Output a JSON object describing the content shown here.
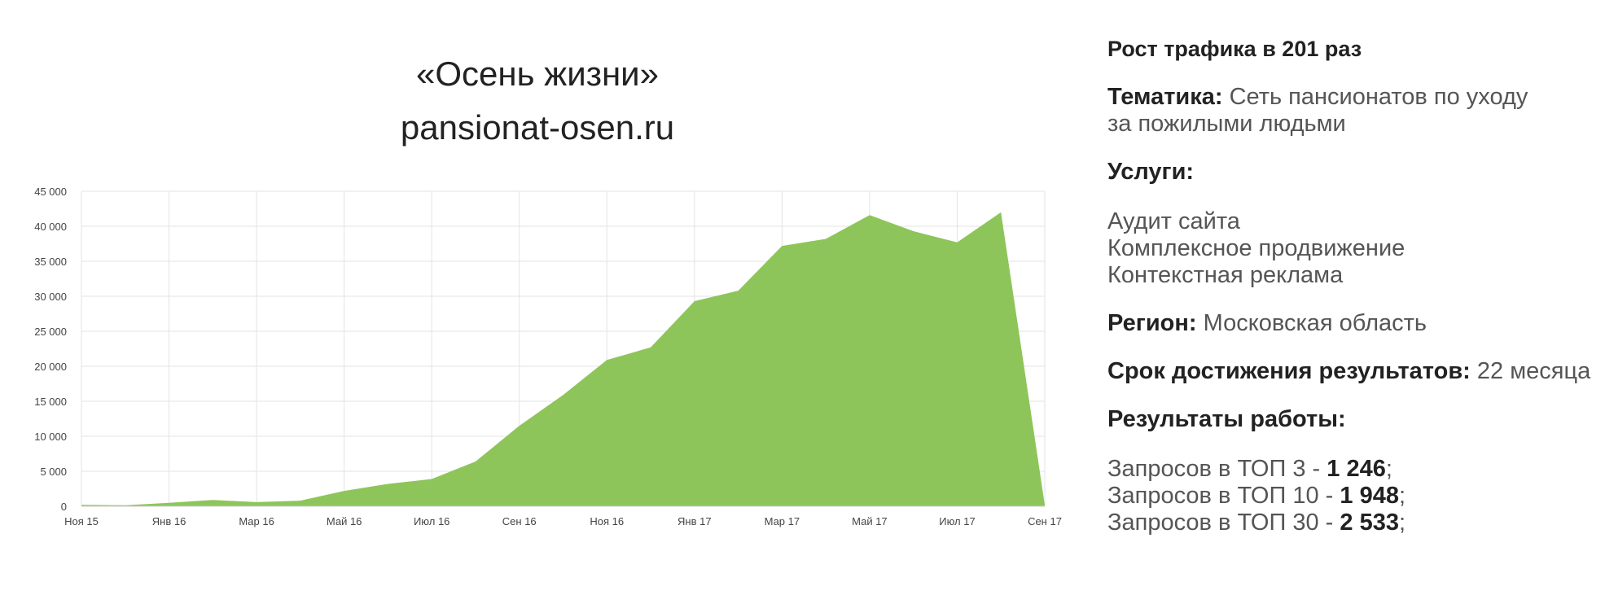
{
  "title": {
    "line1": "«Осень жизни»",
    "line2": "pansionat-osen.ru"
  },
  "info": {
    "headline": "Рост трафика в 201 раз",
    "theme_label": "Тематика:",
    "theme_value_line1": "Сеть пансионатов по уходу",
    "theme_value_line2": "за пожилыми людьми",
    "services_label": "Услуги:",
    "services": [
      "Аудит сайта",
      "Комплексное продвижение",
      "Контекстная реклама"
    ],
    "region_label": "Регион:",
    "region_value": "Московская область",
    "term_label": "Срок достижения результатов:",
    "term_value": "22 месяца",
    "results_label": "Результаты работы:",
    "results": [
      {
        "prefix": "Запросов в ТОП 3 - ",
        "value": "1 246",
        "suffix": ";"
      },
      {
        "prefix": "Запросов в ТОП 10 - ",
        "value": "1 948",
        "suffix": ";"
      },
      {
        "prefix": "Запросов в ТОП 30 - ",
        "value": "2 533",
        "suffix": ";"
      }
    ]
  },
  "chart_data": {
    "type": "area",
    "title": "",
    "xlabel": "",
    "ylabel": "",
    "ylim": [
      0,
      45000
    ],
    "yticks": [
      0,
      5000,
      10000,
      15000,
      20000,
      25000,
      30000,
      35000,
      40000,
      45000
    ],
    "ytick_labels": [
      "0",
      "5 000",
      "10 000",
      "15 000",
      "20 000",
      "25 000",
      "30 000",
      "35 000",
      "40 000",
      "45 000"
    ],
    "xlim": [
      0,
      22
    ],
    "xticks": [
      0,
      2,
      4,
      6,
      8,
      10,
      12,
      14,
      16,
      18,
      20,
      22
    ],
    "xtick_labels": [
      "Ноя 15",
      "Янв 16",
      "Мар 16",
      "Май 16",
      "Июл 16",
      "Сен 16",
      "Ноя 16",
      "Янв 17",
      "Мар 17",
      "Май 17",
      "Июл 17",
      "Сен 17"
    ],
    "grid": true,
    "legend": "none",
    "color": "#8dc55a",
    "x": [
      "Ноя 15",
      "Дек 15",
      "Янв 16",
      "Фев 16",
      "Мар 16",
      "Апр 16",
      "Май 16",
      "Июн 16",
      "Июл 16",
      "Авг 16",
      "Сен 16",
      "Окт 16",
      "Ноя 16",
      "Дек 16",
      "Янв 17",
      "Фев 17",
      "Мар 17",
      "Апр 17",
      "Май 17",
      "Июн 17",
      "Июл 17",
      "Авг 17",
      "Сен 17"
    ],
    "values": [
      200,
      150,
      500,
      900,
      600,
      800,
      2200,
      3200,
      3900,
      6400,
      11500,
      15900,
      20900,
      22700,
      29300,
      30800,
      37200,
      38200,
      41600,
      39300,
      37700,
      42000,
      200
    ]
  }
}
